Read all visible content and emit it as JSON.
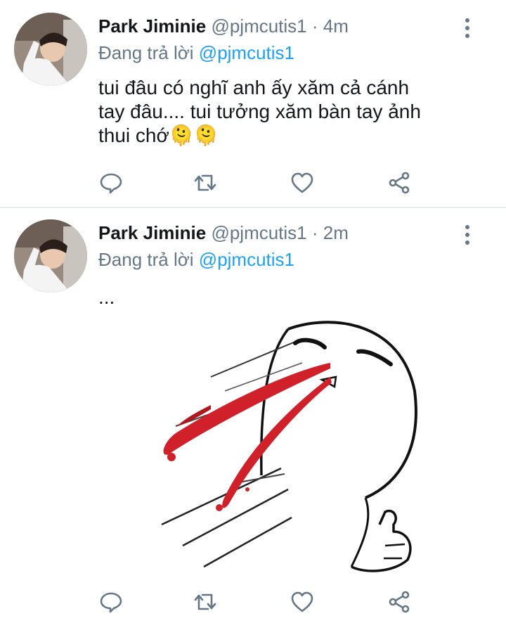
{
  "tweets": [
    {
      "name": "Park Jiminie",
      "handle": "@pjmcutis1",
      "separator": "·",
      "time": "4m",
      "reply_prefix": "Đang trả lời",
      "reply_to": "@pjmcutis1",
      "text_lines": [
        "tui đâu có nghĩ anh ấy xăm cả cánh",
        "tay đâu.... tui tưởng xăm bàn tay ảnh",
        "thui chớ🫠🫠"
      ],
      "has_media": false
    },
    {
      "name": "Park Jiminie",
      "handle": "@pjmcutis1",
      "separator": "·",
      "time": "2m",
      "reply_prefix": "Đang trả lời",
      "reply_to": "@pjmcutis1",
      "text_lines": [
        "..."
      ],
      "has_media": true
    }
  ],
  "icons": {
    "reply": "speech-bubble-icon",
    "retweet": "retweet-icon",
    "like": "heart-icon",
    "share": "share-icon",
    "more": "vertical-dots-icon"
  },
  "colors": {
    "link": "#1da1f2",
    "secondary_text": "#657786",
    "primary_text": "#14171a",
    "blood_red": "#d0202a"
  }
}
